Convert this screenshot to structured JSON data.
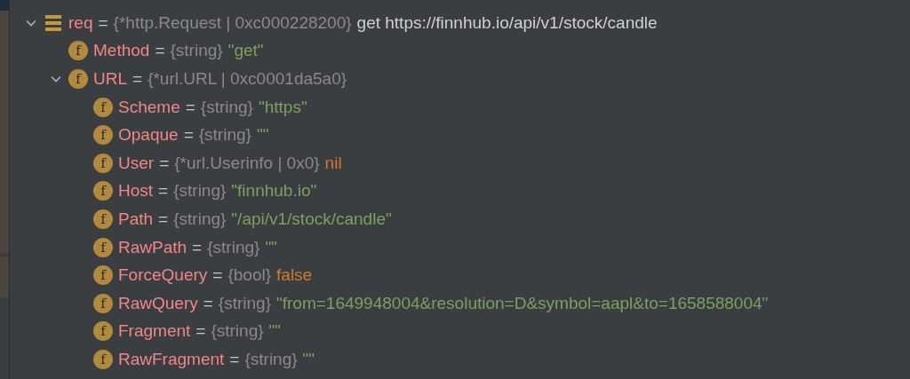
{
  "variables": [
    {
      "name": "req",
      "sep": "=",
      "type": "{*http.Request | 0xc000228200}",
      "value": {
        "text": "get https://finnhub.io/api/v1/stock/candle",
        "kind": "plain"
      },
      "icon": {
        "kind": "struct"
      },
      "expanded": true,
      "children": [
        {
          "name": "Method",
          "sep": "=",
          "type": "{string}",
          "value": {
            "text": "\"get\"",
            "kind": "string"
          },
          "icon": {
            "kind": "field",
            "glyph": "f"
          }
        },
        {
          "name": "URL",
          "sep": "=",
          "type": "{*url.URL | 0xc0001da5a0}",
          "icon": {
            "kind": "field",
            "glyph": "f"
          },
          "expanded": true,
          "children": [
            {
              "name": "Scheme",
              "sep": "=",
              "type": "{string}",
              "value": {
                "text": "\"https\"",
                "kind": "string"
              },
              "icon": {
                "kind": "field",
                "glyph": "f"
              }
            },
            {
              "name": "Opaque",
              "sep": "=",
              "type": "{string}",
              "value": {
                "text": "\"\"",
                "kind": "string"
              },
              "icon": {
                "kind": "field",
                "glyph": "f"
              }
            },
            {
              "name": "User",
              "sep": "=",
              "type": "{*url.Userinfo | 0x0}",
              "value": {
                "text": "nil",
                "kind": "keyword"
              },
              "icon": {
                "kind": "field",
                "glyph": "f"
              }
            },
            {
              "name": "Host",
              "sep": "=",
              "type": "{string}",
              "value": {
                "text": "\"finnhub.io\"",
                "kind": "string"
              },
              "icon": {
                "kind": "field",
                "glyph": "f"
              }
            },
            {
              "name": "Path",
              "sep": "=",
              "type": "{string}",
              "value": {
                "text": "\"/api/v1/stock/candle\"",
                "kind": "string"
              },
              "icon": {
                "kind": "field",
                "glyph": "f"
              }
            },
            {
              "name": "RawPath",
              "sep": "=",
              "type": "{string}",
              "value": {
                "text": "\"\"",
                "kind": "string"
              },
              "icon": {
                "kind": "field",
                "glyph": "f"
              }
            },
            {
              "name": "ForceQuery",
              "sep": "=",
              "type": "{bool}",
              "value": {
                "text": "false",
                "kind": "keyword"
              },
              "icon": {
                "kind": "field",
                "glyph": "f"
              }
            },
            {
              "name": "RawQuery",
              "sep": "=",
              "type": "{string}",
              "value": {
                "text": "\"from=1649948004&resolution=D&symbol=aapl&to=1658588004\"",
                "kind": "string"
              },
              "icon": {
                "kind": "field",
                "glyph": "f"
              }
            },
            {
              "name": "Fragment",
              "sep": "=",
              "type": "{string}",
              "value": {
                "text": "\"\"",
                "kind": "string"
              },
              "icon": {
                "kind": "field",
                "glyph": "f"
              }
            },
            {
              "name": "RawFragment",
              "sep": "=",
              "type": "{string}",
              "value": {
                "text": "\"\"",
                "kind": "string"
              },
              "icon": {
                "kind": "field",
                "glyph": "f"
              }
            }
          ]
        }
      ]
    }
  ]
}
